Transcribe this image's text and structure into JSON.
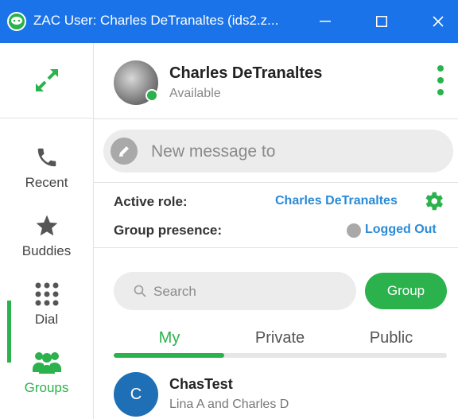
{
  "window": {
    "title": "ZAC User: Charles DeTranaltes (ids2.z...",
    "brand_color": "#1a73e8",
    "accent_color": "#2bb24c"
  },
  "sidebar": {
    "items": [
      {
        "label": "Recent",
        "icon": "phone-icon"
      },
      {
        "label": "Buddies",
        "icon": "star-icon"
      },
      {
        "label": "Dial",
        "icon": "dialpad-icon"
      },
      {
        "label": "Groups",
        "icon": "groups-icon",
        "active": true
      }
    ]
  },
  "user": {
    "name": "Charles DeTranaltes",
    "status": "Available"
  },
  "compose": {
    "placeholder": "New message to"
  },
  "role": {
    "active_role_label": "Active role:",
    "active_role_value": "Charles DeTranaltes",
    "group_presence_label": "Group presence:",
    "group_presence_value": "Logged Out"
  },
  "groups": {
    "search_placeholder": "Search",
    "group_button": "Group",
    "tabs": [
      "My",
      "Private",
      "Public"
    ],
    "active_tab": "My",
    "items": [
      {
        "initial": "C",
        "name": "ChasTest",
        "members": "Lina A and Charles D"
      }
    ]
  }
}
